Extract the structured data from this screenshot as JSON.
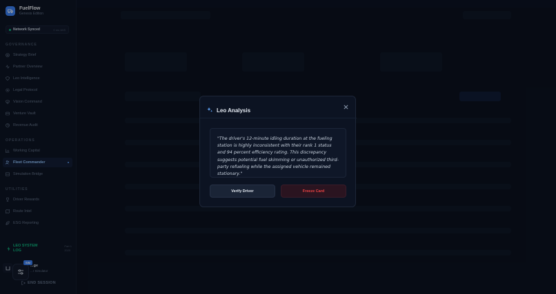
{
  "brand": {
    "title": "FuelFlow",
    "subtitle": "Genesis Edition"
  },
  "sync": {
    "label": "Network Synced",
    "meta": "0 ms 48/5"
  },
  "sections": {
    "governance": "GOVERNANCE",
    "operations": "OPERATIONS",
    "utilities": "UTILITIES"
  },
  "nav": {
    "governance": [
      "Strategy Brief",
      "Partner Overview",
      "Leo Intelligence",
      "Legal Protocol",
      "Vision Command",
      "Venture Vault",
      "Revenue Audit"
    ],
    "operations": [
      "Working Capital",
      "Fleet Commander",
      "Simulation Bridge"
    ],
    "utilities": [
      "Driver Rewards",
      "Route Intel",
      "ESG Reporting"
    ]
  },
  "log": {
    "title_line1": "LEO SYSTEM",
    "title_line2": "LOG",
    "meta_line1": "Part 1",
    "meta_line2": "2025"
  },
  "user": {
    "badge": "SIM",
    "name": "...ge",
    "role": "...r Simulator"
  },
  "end_session": "END SESSION",
  "modal": {
    "title": "Leo Analysis",
    "quote": "\"The driver's 12-minute idling duration at the fueling station is highly inconsistent with their rank 1 status and 94 percent efficiency rating. This discrepancy suggests potential fuel skimming or unauthorized third-party refueling while the assigned vehicle remained stationary.\"",
    "verify_label": "Verify Driver",
    "freeze_label": "Freeze Card"
  },
  "colors": {
    "accent": "#3b82f6",
    "success": "#10b981",
    "danger": "#ef4444"
  }
}
